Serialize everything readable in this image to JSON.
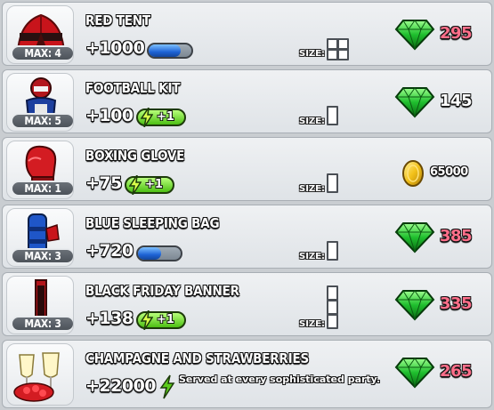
{
  "colors": {
    "gem_price": "#ff6f8a",
    "plain_price": "#ffffff",
    "progress_blue": "#1e63d6",
    "boost_green": "#4cbf13"
  },
  "items": [
    {
      "name": "RED TENT",
      "max": "MAX: 4",
      "gain": "+1000",
      "boost": "progress-bar",
      "progress": 1.0,
      "size_label": "SIZE:",
      "size_cells": "2x2",
      "price": "295",
      "currency": "gem-icon"
    },
    {
      "name": "FOOTBALL KIT",
      "max": "MAX: 5",
      "gain": "+100",
      "boost": "+1",
      "size_label": "SIZE:",
      "size_cells": "1x1",
      "price": "145",
      "currency": "gem-icon"
    },
    {
      "name": "BOXING GLOVE",
      "max": "MAX: 1",
      "gain": "+75",
      "boost": "+1",
      "size_label": "SIZE:",
      "size_cells": "1x1",
      "price": "65000",
      "currency": "coin-icon"
    },
    {
      "name": "BLUE SLEEPING BAG",
      "max": "MAX: 3",
      "gain": "+720",
      "boost": "progress-bar",
      "progress": 0.55,
      "size_label": "SIZE:",
      "size_cells": "1x1",
      "price": "385",
      "currency": "gem-icon"
    },
    {
      "name": "BLACK FRIDAY BANNER",
      "max": "MAX: 3",
      "gain": "+138",
      "boost": "+1",
      "size_label": "SIZE:",
      "size_cells": "1x3",
      "price": "335",
      "currency": "gem-icon"
    },
    {
      "name": "CHAMPAGNE AND STRAWBERRIES",
      "max": "",
      "gain": "+22000",
      "boost": "bolt",
      "description": "Served at every sophisticated party.",
      "price": "265",
      "currency": "gem-icon"
    }
  ]
}
